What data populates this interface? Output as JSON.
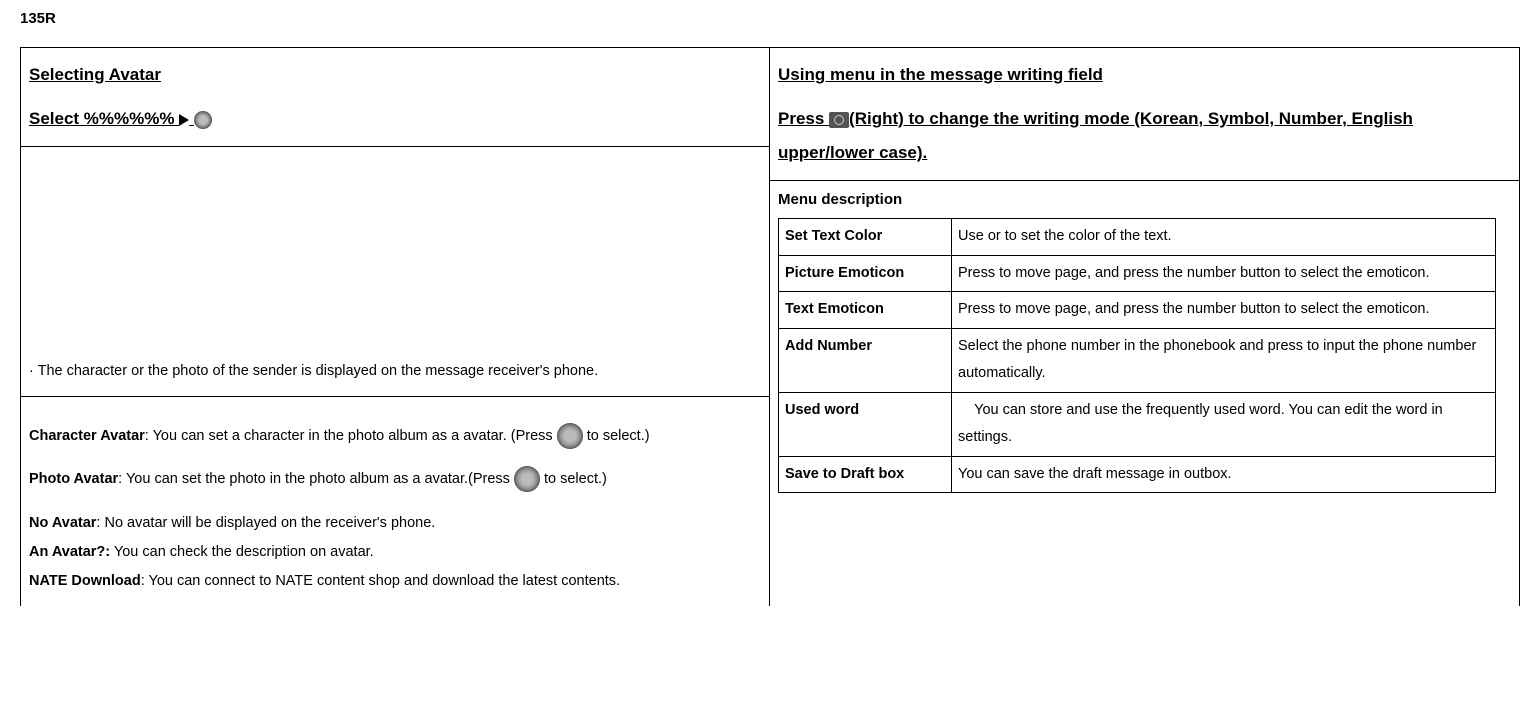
{
  "header": "135R",
  "left": {
    "title1": "Selecting Avatar",
    "title2_prefix": "Select %%%%%% ",
    "desc_line": "· The character or the photo of the sender is displayed on the message receiver's phone.",
    "char_avatar_label": "Character Avatar",
    "char_avatar_text_a": ": You can set a character in the photo album as a avatar. (Press ",
    "char_avatar_text_b": " to select.)",
    "photo_avatar_label": "Photo Avatar",
    "photo_avatar_text_a": ": You can set the photo in the photo album as a avatar.(Press ",
    "photo_avatar_text_b": " to select.)",
    "no_avatar_label": "No Avatar",
    "no_avatar_text": ": No avatar will be displayed on the receiver's phone.",
    "an_avatar_label": "An Avatar?:",
    "an_avatar_text": " You can check the description on avatar.",
    "nate_label": "NATE Download",
    "nate_text": ": You can connect to NATE content shop and download the latest contents."
  },
  "right": {
    "title_a": "Using menu in the message writing field",
    "title_b_pre": "Press ",
    "title_b_post": "(Right) to change the writing mode (Korean, Symbol, Number, English upper/lower case).",
    "menu_desc_heading": "Menu description",
    "rows": [
      {
        "name": "Set Text Color",
        "desc": "Use or to set the color of the text."
      },
      {
        "name": "Picture Emoticon",
        "desc": "Press to move page, and press the number button to select the emoticon."
      },
      {
        "name": "Text Emoticon",
        "desc": "Press to move page, and press the number button to select the emoticon."
      },
      {
        "name": "Add Number",
        "desc": "Select the phone number in the phonebook and press to input the phone number automatically."
      },
      {
        "name": "Used word",
        "desc": "    You can store and use the frequently used word. You can edit the word in settings."
      },
      {
        "name": "Save to Draft box",
        "desc": "You can save the draft message in outbox."
      }
    ]
  }
}
